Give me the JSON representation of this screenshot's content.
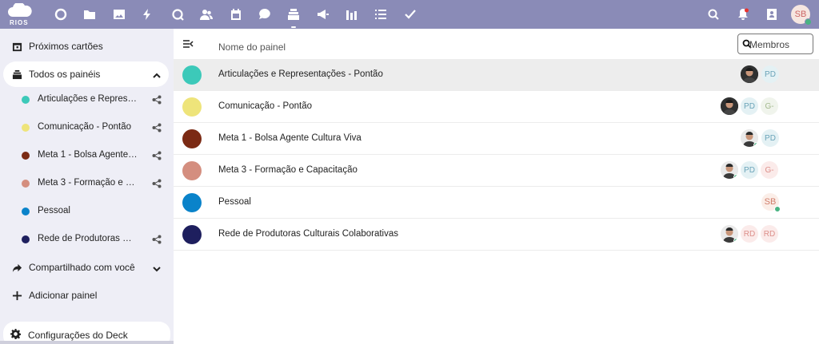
{
  "topbar": {
    "brand": "RIOS",
    "avatar_initials": "SB",
    "colors": {
      "bar": "#8a8bb7",
      "online": "#49b382"
    },
    "apps": [
      "dashboard-icon",
      "files-icon",
      "photos-icon",
      "activity-icon",
      "search-app-icon",
      "contacts-icon",
      "calendar-icon",
      "talk-icon",
      "deck-icon",
      "announcements-icon",
      "analytics-icon",
      "tasks-icon",
      "checkmark-icon"
    ],
    "right_icons": [
      "search-icon",
      "notifications-icon",
      "contacts-menu-icon"
    ]
  },
  "sidebar": {
    "upcoming": "Próximos cartões",
    "all_boards": "Todos os painéis",
    "boards": [
      {
        "label": "Articulações e Representações - Pontão",
        "color": "#3cc9b9",
        "shared": true
      },
      {
        "label": "Comunicação - Pontão",
        "color": "#eee47a",
        "shared": true
      },
      {
        "label": "Meta 1 - Bolsa Agente Cultura Viva",
        "color": "#7b2a14",
        "shared": true
      },
      {
        "label": "Meta 3 - Formação e Capacitação",
        "color": "#d48e7f",
        "shared": true
      },
      {
        "label": "Pessoal",
        "color": "#0a83ca",
        "shared": false
      },
      {
        "label": "Rede de Produtoras Culturais Colaborativas",
        "color": "#1e1f5e",
        "shared": true
      }
    ],
    "shared_with_you": "Compartilhado com você",
    "add_board": "Adicionar painel",
    "settings": "Configurações do Deck"
  },
  "main": {
    "column_name": "Nome do painel",
    "members_placeholder": "Membros",
    "rows": [
      {
        "title": "Articulações e Representações - Pontão",
        "color": "#3cc9b9",
        "members": [
          "photo",
          "PD"
        ]
      },
      {
        "title": "Comunicação - Pontão",
        "color": "#eee47a",
        "members": [
          "photo",
          "PD",
          "G-"
        ]
      },
      {
        "title": "Meta 1 - Bolsa Agente Cultura Viva",
        "color": "#7b2a14",
        "members": [
          "photo",
          "PD"
        ]
      },
      {
        "title": "Meta 3 - Formação e Capacitação",
        "color": "#d48e7f",
        "members": [
          "photo",
          "PD",
          "G-"
        ]
      },
      {
        "title": "Pessoal",
        "color": "#0a83ca",
        "members": [
          "SB"
        ]
      },
      {
        "title": "Rede de Produtoras Culturais Colaborativas",
        "color": "#1e1f5e",
        "members": [
          "photo",
          "RD",
          "RD"
        ]
      }
    ]
  }
}
